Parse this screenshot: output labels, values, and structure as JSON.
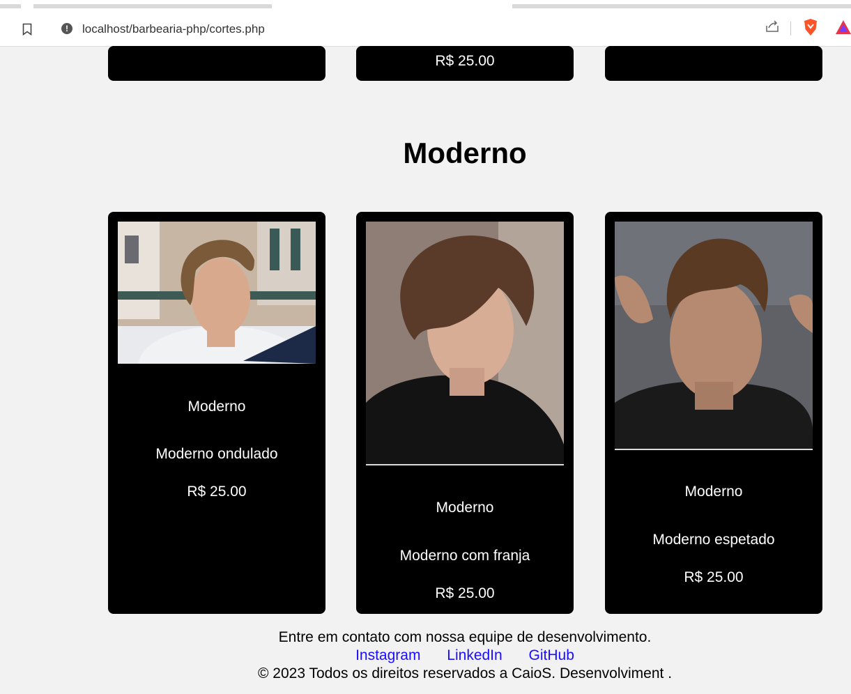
{
  "browser": {
    "url": "localhost/barbearia-php/cortes.php"
  },
  "top_cards": [
    {
      "price": ""
    },
    {
      "price": "R$ 25.00"
    },
    {
      "price": ""
    }
  ],
  "section": {
    "title": "Moderno"
  },
  "cards": [
    {
      "category": "Moderno",
      "name": "Moderno ondulado",
      "price": "R$ 25.00",
      "photo": "man-wavy-hair-photo"
    },
    {
      "category": "Moderno",
      "name": "Moderno com franja",
      "price": "R$ 25.00",
      "photo": "man-fringe-hair-photo"
    },
    {
      "category": "Moderno",
      "name": "Moderno espetado",
      "price": "R$ 25.00",
      "photo": "man-spiky-hair-photo"
    }
  ],
  "footer": {
    "contact": "Entre em contato com nossa equipe de desenvolvimento.",
    "links": [
      "Instagram",
      "LinkedIn",
      "GitHub"
    ],
    "copyright": "© 2023 Todos os direitos reservados a CaioS. Desenvolviment ."
  },
  "colors": {
    "card_bg": "#000000",
    "page_bg": "#f2f2f2",
    "link": "#1a0dff",
    "brave_orange": "#fb542b"
  }
}
